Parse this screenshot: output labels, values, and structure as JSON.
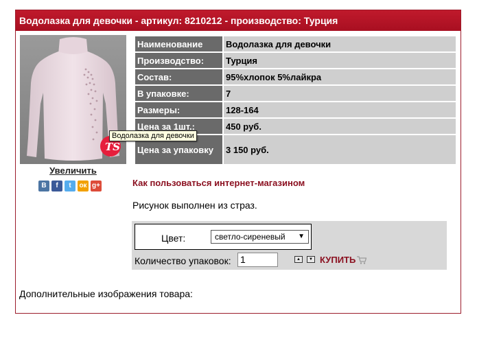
{
  "header": {
    "title": "Водолазка для девочки - артикул: 8210212 - производство: Турция"
  },
  "product": {
    "image_tooltip": "Водолазка для девочки",
    "enlarge_link": "Увеличить",
    "logo_text": "TS"
  },
  "social": [
    {
      "label": "B",
      "icon": "vkontakte-icon",
      "color": "#4c75a3"
    },
    {
      "label": "f",
      "icon": "facebook-icon",
      "color": "#3b5998"
    },
    {
      "label": "t",
      "icon": "twitter-icon",
      "color": "#55acee"
    },
    {
      "label": "ок",
      "icon": "odnoklassniki-icon",
      "color": "#f2a100"
    },
    {
      "label": "g+",
      "icon": "google-plus-icon",
      "color": "#dd4b39"
    }
  ],
  "specs": [
    {
      "key": "Наименование",
      "value": "Водолазка для девочки"
    },
    {
      "key": "Производство:",
      "value": "Турция"
    },
    {
      "key": "Состав:",
      "value": "95%хлопок 5%лайкра"
    },
    {
      "key": "В упаковке:",
      "value": "7"
    },
    {
      "key": "Размеры:",
      "value": "128-164"
    },
    {
      "key": "Цена за 1шт.:",
      "value": "450 руб."
    },
    {
      "key": "Цена за упаковку",
      "value": "3 150 руб."
    }
  ],
  "howto_link": "Как пользоваться интернет-магазином",
  "description": "Рисунок выполнен из страз.",
  "order": {
    "color_label": "Цвет:",
    "color_value": "светло-сиреневый",
    "quantity_label": "Количество упаковок:",
    "quantity_value": "1",
    "buy_label": "КУПИТЬ"
  },
  "extra_images_label": "Дополнительные изображения товара:",
  "colors": {
    "brand": "#a80f21",
    "link": "#8b1020",
    "key_cell": "#6a6a6a",
    "value_cell": "#cfcfcf"
  }
}
